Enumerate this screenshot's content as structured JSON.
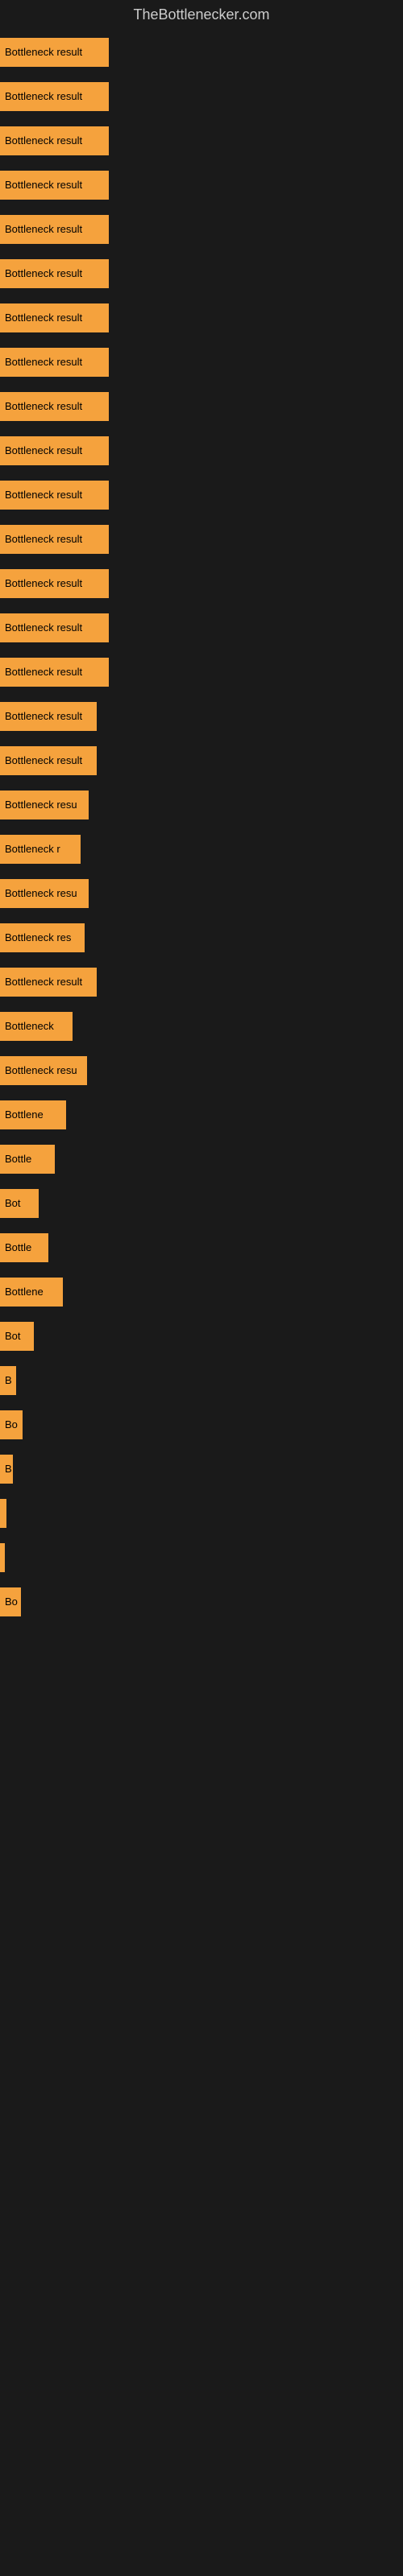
{
  "site": {
    "title": "TheBottlenecker.com"
  },
  "bars": [
    {
      "label": "Bottleneck result",
      "width": 135
    },
    {
      "label": "Bottleneck result",
      "width": 135
    },
    {
      "label": "Bottleneck result",
      "width": 135
    },
    {
      "label": "Bottleneck result",
      "width": 135
    },
    {
      "label": "Bottleneck result",
      "width": 135
    },
    {
      "label": "Bottleneck result",
      "width": 135
    },
    {
      "label": "Bottleneck result",
      "width": 135
    },
    {
      "label": "Bottleneck result",
      "width": 135
    },
    {
      "label": "Bottleneck result",
      "width": 135
    },
    {
      "label": "Bottleneck result",
      "width": 135
    },
    {
      "label": "Bottleneck result",
      "width": 135
    },
    {
      "label": "Bottleneck result",
      "width": 135
    },
    {
      "label": "Bottleneck result",
      "width": 135
    },
    {
      "label": "Bottleneck result",
      "width": 135
    },
    {
      "label": "Bottleneck result",
      "width": 135
    },
    {
      "label": "Bottleneck result",
      "width": 120
    },
    {
      "label": "Bottleneck result",
      "width": 120
    },
    {
      "label": "Bottleneck resu",
      "width": 110
    },
    {
      "label": "Bottleneck r",
      "width": 100
    },
    {
      "label": "Bottleneck resu",
      "width": 110
    },
    {
      "label": "Bottleneck res",
      "width": 105
    },
    {
      "label": "Bottleneck result",
      "width": 120
    },
    {
      "label": "Bottleneck ",
      "width": 90
    },
    {
      "label": "Bottleneck resu",
      "width": 108
    },
    {
      "label": "Bottlene",
      "width": 82
    },
    {
      "label": "Bottle",
      "width": 68
    },
    {
      "label": "Bot",
      "width": 48
    },
    {
      "label": "Bottle",
      "width": 60
    },
    {
      "label": "Bottlene",
      "width": 78
    },
    {
      "label": "Bot",
      "width": 42
    },
    {
      "label": "B",
      "width": 20
    },
    {
      "label": "Bo",
      "width": 28
    },
    {
      "label": "B",
      "width": 16
    },
    {
      "label": "",
      "width": 8
    },
    {
      "label": "",
      "width": 4
    },
    {
      "label": "Bo",
      "width": 26
    }
  ]
}
